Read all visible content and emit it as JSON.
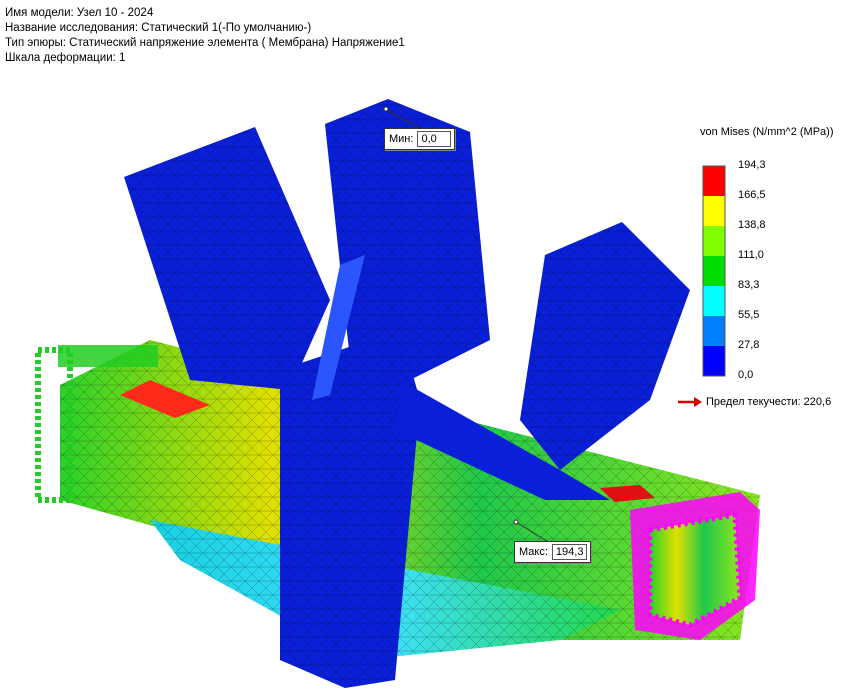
{
  "header": {
    "model_name": "Имя модели: Узел 10 - 2024",
    "study_name": "Название исследования: Статический 1(-По умолчанию-)",
    "plot_type": "Тип эпюры: Статический напряжение элемента ( Мембрана) Напряжение1",
    "deformation_scale": "Шкала деформации: 1"
  },
  "callouts": {
    "min": {
      "label": "Мин:",
      "value": "0,0"
    },
    "max": {
      "label": "Макс:",
      "value": "194,3"
    }
  },
  "legend": {
    "title": "von Mises (N/mm^2 (MPa))",
    "ticks": [
      "194,3",
      "166,5",
      "138,8",
      "111,0",
      "83,3",
      "55,5",
      "27,8",
      "0,0"
    ],
    "bands": [
      "#ff0000",
      "#ffff00",
      "#80ff00",
      "#00dd00",
      "#00ffff",
      "#0080ff",
      "#0000ff"
    ],
    "yield_label": "Предел текучести: 220,6",
    "yield_arrow_color": "#d40000"
  },
  "colors": {
    "low_stress": "#0a1fd8",
    "mid_stress": "#19c21f",
    "high_stress": "#e8e800",
    "fixture": "#22cc22",
    "load": "#ff00ff"
  }
}
